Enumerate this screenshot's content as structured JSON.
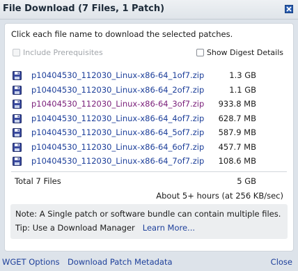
{
  "dialog": {
    "title": "File Download (7 Files, 1 Patch)",
    "close_icon": "close-x-icon"
  },
  "content": {
    "instructions": "Click each file name to download the selected patches.",
    "include_prerequisites_label": "Include Prerequisites",
    "show_digest_label": "Show Digest Details",
    "files": [
      {
        "name": "p10404530_112030_Linux-x86-64_1of7.zip",
        "size": "1.3 GB",
        "icon": "save-disk-icon"
      },
      {
        "name": "p10404530_112030_Linux-x86-64_2of7.zip",
        "size": "1.1 GB",
        "icon": "save-disk-icon"
      },
      {
        "name": "p10404530_112030_Linux-x86-64_3of7.zip",
        "size": "933.8 MB",
        "icon": "save-disk-icon"
      },
      {
        "name": "p10404530_112030_Linux-x86-64_4of7.zip",
        "size": "628.7 MB",
        "icon": "save-disk-icon"
      },
      {
        "name": "p10404530_112030_Linux-x86-64_5of7.zip",
        "size": "587.9 MB",
        "icon": "save-disk-icon"
      },
      {
        "name": "p10404530_112030_Linux-x86-64_6of7.zip",
        "size": "457.7 MB",
        "icon": "save-disk-icon"
      },
      {
        "name": "p10404530_112030_Linux-x86-64_7of7.zip",
        "size": "108.6 MB",
        "icon": "save-disk-icon"
      }
    ],
    "total_label": "Total 7 Files",
    "total_size": "5 GB",
    "estimate": "About 5+ hours (at 256 KB/sec)",
    "note": "Note: A Single patch or software bundle can contain multiple files.",
    "tip": "Tip: Use a Download Manager",
    "learn_more": "Learn More..."
  },
  "footer": {
    "wget_options": "WGET Options",
    "download_metadata": "Download Patch Metadata",
    "close": "Close"
  },
  "colors": {
    "link": "#1d3f9a",
    "visited_link": "#7a1f7a",
    "dialog_background": "#dde3ea"
  }
}
